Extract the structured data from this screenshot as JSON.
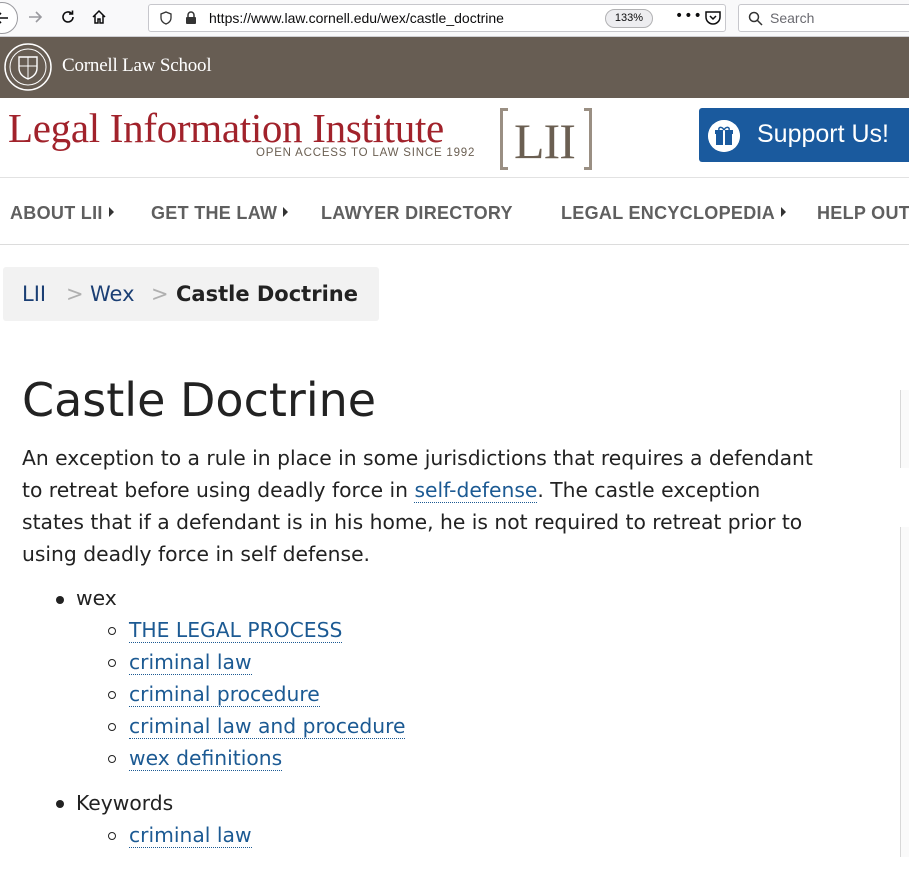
{
  "browser": {
    "url": "https://www.law.cornell.edu/wex/castle_doctrine",
    "zoom": "133%",
    "page_actions": "•••",
    "search_placeholder": "Search"
  },
  "cornell_bar": {
    "school_name": "Cornell Law School"
  },
  "header": {
    "site_title": "Legal Information Institute",
    "tagline": "OPEN ACCESS TO LAW SINCE 1992",
    "logo_text": "LII",
    "support_label": "Support Us!"
  },
  "nav": {
    "items": [
      {
        "label": "ABOUT LII"
      },
      {
        "label": "GET THE LAW"
      },
      {
        "label": "LAWYER DIRECTORY"
      },
      {
        "label": "LEGAL ENCYCLOPEDIA"
      },
      {
        "label": "HELP OUT"
      }
    ]
  },
  "breadcrumb": {
    "root": "LII",
    "sep": ">",
    "section": "Wex",
    "current": "Castle Doctrine"
  },
  "article": {
    "title": "Castle Doctrine",
    "line1": "An exception to a rule in place in some jurisdictions that requires a defendant",
    "line2_pre": "to retreat before using deadly force in ",
    "line2_link": "self-defense",
    "line2_post": ". The castle exception",
    "line3": "states that if a defendant is in his home, he is not required to retreat prior to",
    "line4": "using deadly force in self defense."
  },
  "categories": {
    "wex_label": "wex",
    "wex_links": [
      "THE LEGAL PROCESS",
      "criminal law",
      "criminal procedure",
      "criminal law and procedure",
      "wex definitions"
    ],
    "keywords_label": "Keywords",
    "keyword_links": [
      "criminal law"
    ]
  }
}
